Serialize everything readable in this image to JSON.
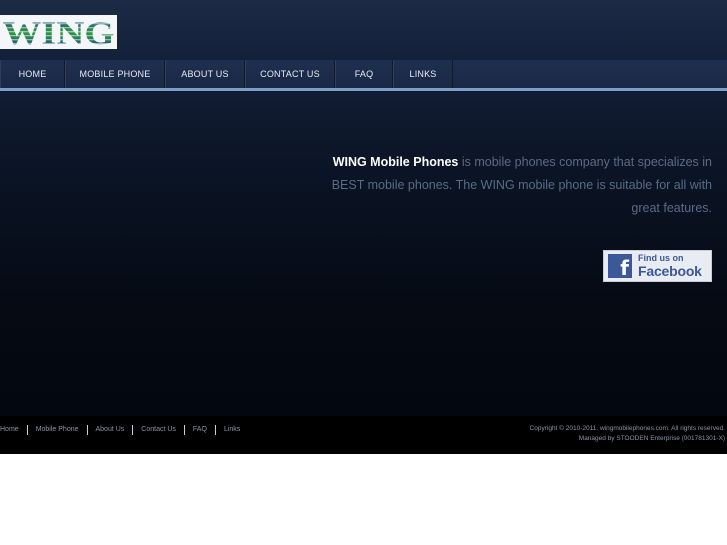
{
  "header": {
    "logo_text": "WING",
    "logo_colors": [
      "#2b4aa3",
      "#2f9a3e",
      "#1f3f95"
    ]
  },
  "nav": {
    "items": [
      {
        "label": "HOME"
      },
      {
        "label": "MOBILE PHONE"
      },
      {
        "label": "ABOUT US"
      },
      {
        "label": "CONTACT US"
      },
      {
        "label": "FAQ"
      },
      {
        "label": "LINKS"
      }
    ]
  },
  "intro": {
    "brand": "WING Mobile Phones",
    "text": " is mobile phones company that specializes in BEST mobile phones. The WING mobile phone is suitable for all with great features."
  },
  "facebook": {
    "icon": "f",
    "line1": "Find us on",
    "line2": "Facebook",
    "color": "#3b5998"
  },
  "footer": {
    "links": [
      {
        "label": "Home"
      },
      {
        "label": "Mobile Phone"
      },
      {
        "label": "About Us"
      },
      {
        "label": "Contact Us"
      },
      {
        "label": "FAQ"
      },
      {
        "label": "Links"
      }
    ],
    "copyright": "Copyright © 2010-2011. wingmobilephones.com. All rights reserved.",
    "managed": "Managed by STOODEN Enterprise (001781301-X)"
  },
  "colors": {
    "background_top": "#1c2a45",
    "background_bottom": "#03070f",
    "nav_underline": "#7f9dc4",
    "footer_bg": "#000000"
  }
}
